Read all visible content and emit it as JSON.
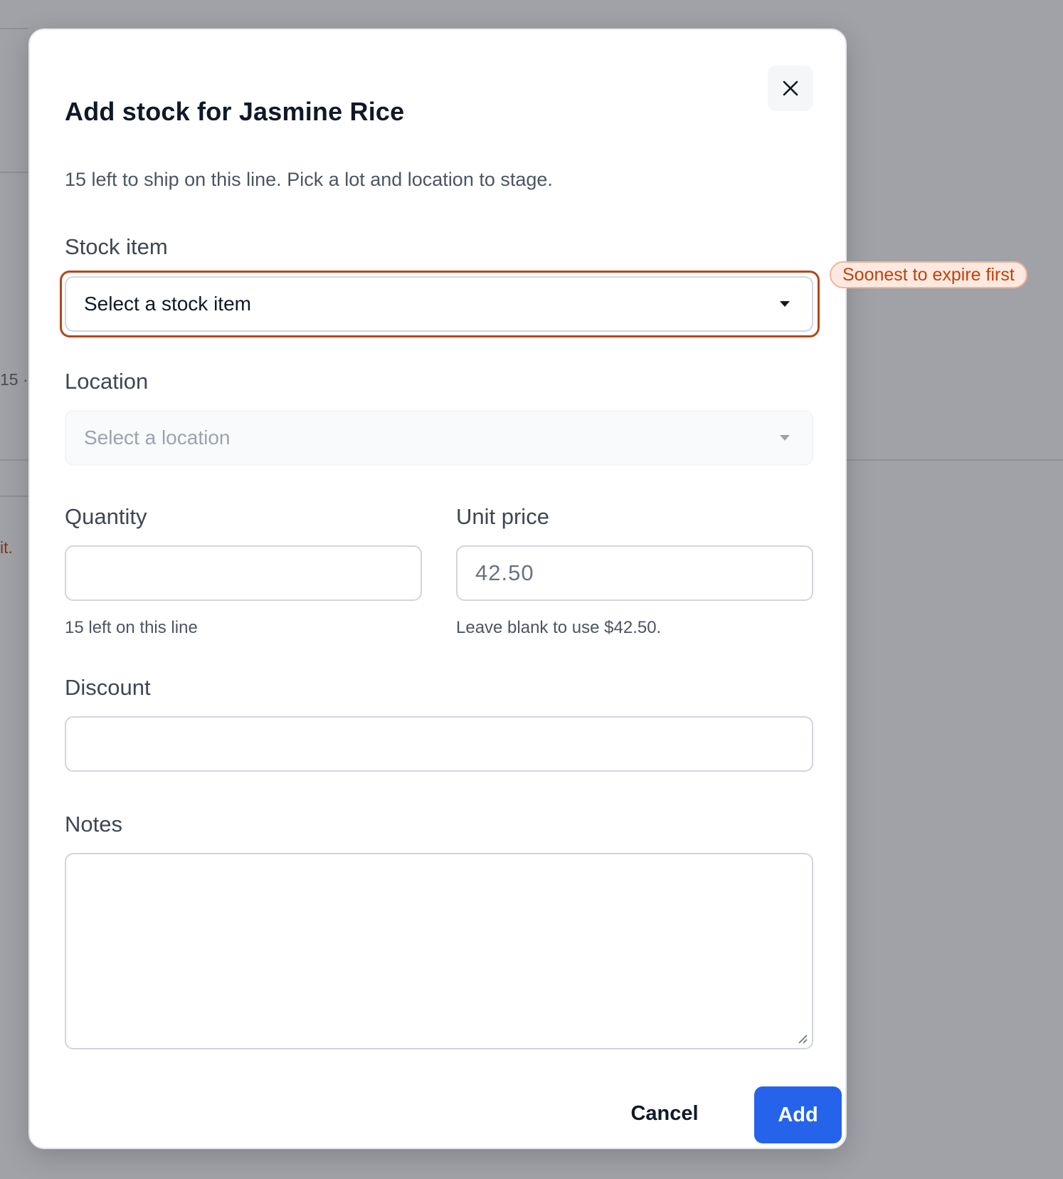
{
  "background": {
    "text_fragment_1": "15 ·",
    "text_fragment_2": "it."
  },
  "dialog": {
    "title": "Add stock for Jasmine Rice",
    "description": "15 left to ship on this line. Pick a lot and location to stage.",
    "close_icon": "close-icon",
    "stock_item": {
      "label": "Stock item",
      "value": "Select a stock item",
      "badge": "Soonest to expire first"
    },
    "location": {
      "label": "Location",
      "value": "Select a location"
    },
    "quantity": {
      "label": "Quantity",
      "value": "",
      "hint": "15 left on this line"
    },
    "unit_price": {
      "label": "Unit price",
      "placeholder": "42.50",
      "hint": "Leave blank to use $42.50."
    },
    "discount": {
      "label": "Discount",
      "value": ""
    },
    "notes": {
      "label": "Notes",
      "value": ""
    },
    "actions": {
      "cancel_label": "Cancel",
      "add_label": "Add"
    }
  },
  "colors": {
    "primary": "#2563eb",
    "focus_ring": "#b4461a",
    "badge_text": "#c2410c",
    "badge_bg": "#fde9df"
  }
}
